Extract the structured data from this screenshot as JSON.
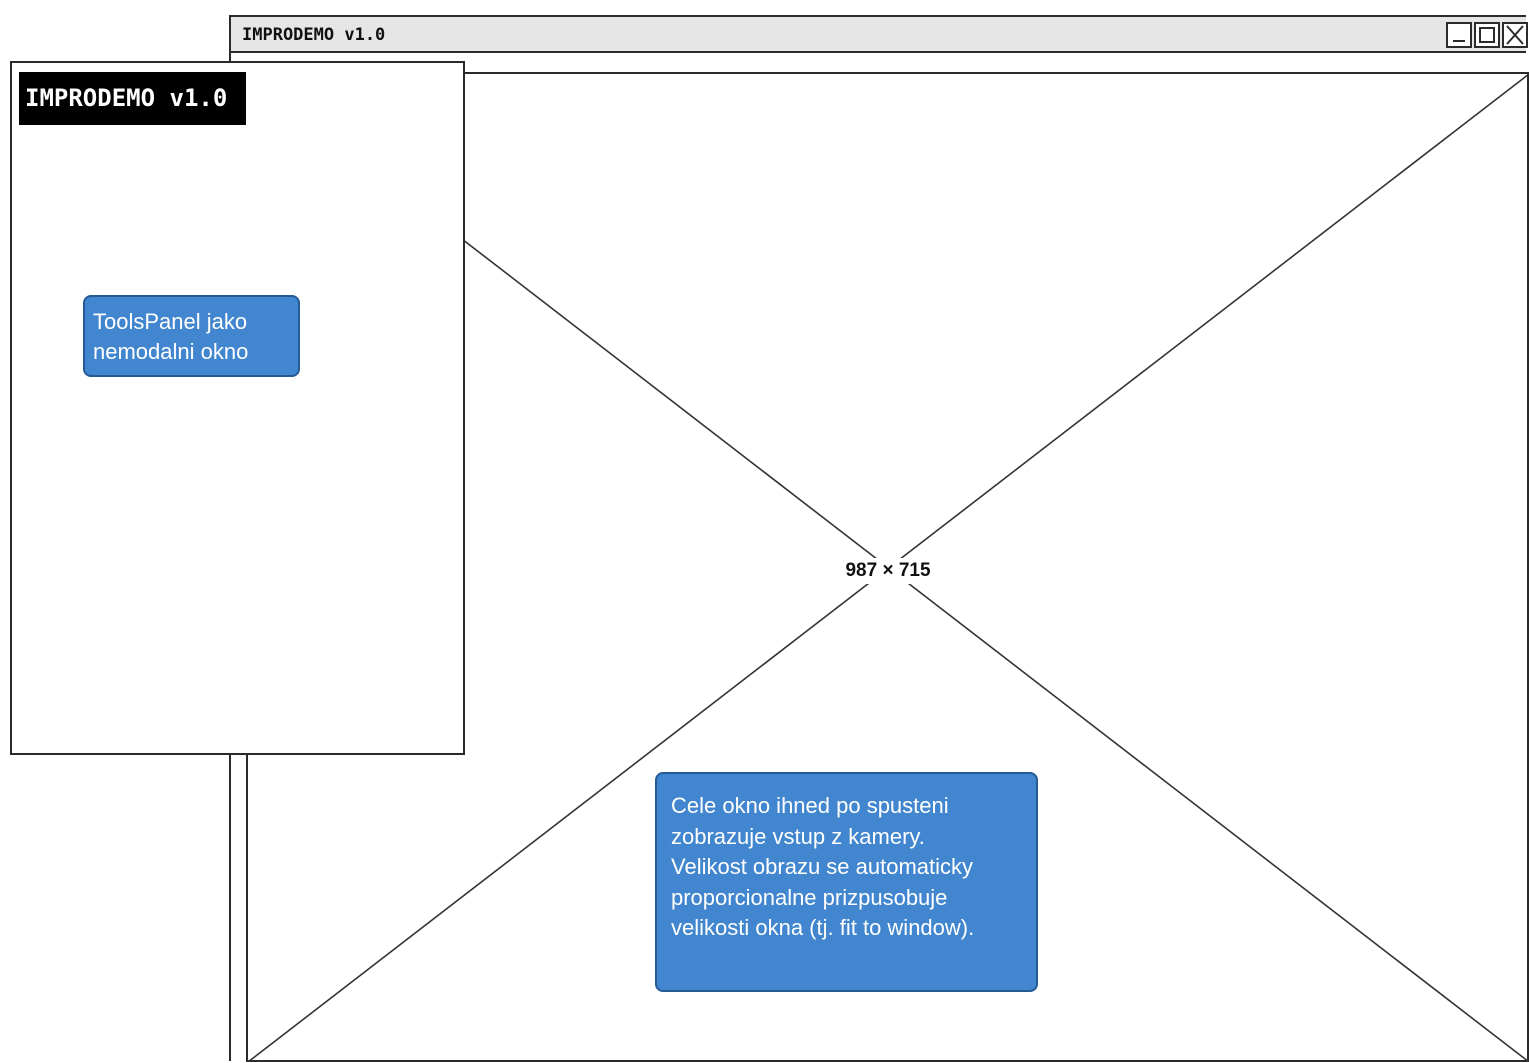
{
  "main_window": {
    "title": "IMPRODEMO v1.0",
    "controls": [
      "minimize",
      "maximize",
      "close"
    ]
  },
  "image_placeholder": {
    "dimensions_label": "987 × 715"
  },
  "tools_panel": {
    "title": "IMPRODEMO v1.0"
  },
  "callouts": {
    "tools_panel_note": {
      "lines": [
        "ToolsPanel jako",
        "nemodalni okno"
      ]
    },
    "main_window_note": {
      "lines": [
        "Cele okno ihned po spusteni",
        "zobrazuje vstup z kamery.",
        "Velikost obrazu se automaticky",
        "proporcionalne prizpusobuje",
        "velikosti okna (tj. fit to window)."
      ]
    }
  },
  "colors": {
    "callout_fill": "#4186ce",
    "callout_border": "#245a96",
    "window_titlebar": "#e6e6e6",
    "panel_title_bg": "#000000"
  },
  "icons": {
    "minimize": "minimize-icon",
    "maximize": "maximize-icon",
    "close": "close-icon"
  }
}
